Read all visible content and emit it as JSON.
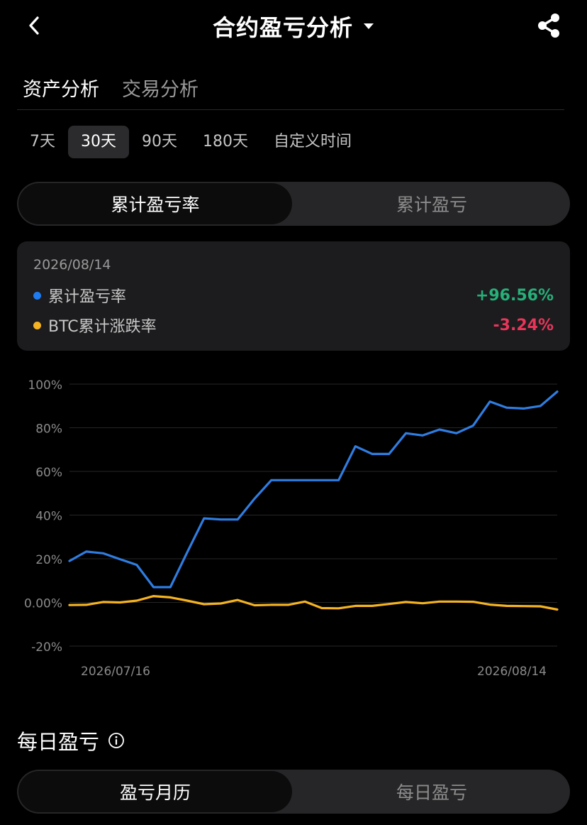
{
  "header": {
    "title": "合约盈亏分析",
    "back_icon": "chevron-left-icon",
    "dropdown_icon": "caret-down-icon",
    "share_icon": "share-icon"
  },
  "tabs": [
    {
      "label": "资产分析",
      "active": true
    },
    {
      "label": "交易分析",
      "active": false
    }
  ],
  "ranges": [
    {
      "label": "7天",
      "active": false
    },
    {
      "label": "30天",
      "active": true
    },
    {
      "label": "90天",
      "active": false
    },
    {
      "label": "180天",
      "active": false
    },
    {
      "label": "自定义时间",
      "active": false
    }
  ],
  "metric_toggle": {
    "left": "累计盈亏率",
    "right": "累计盈亏",
    "selected": "left"
  },
  "info_card": {
    "date": "2026/08/14",
    "rows": [
      {
        "label": "累计盈亏率",
        "value": "+96.56%",
        "dot_color": "#1e7cf0",
        "value_color": "#26b07a"
      },
      {
        "label": "BTC累计涨跌率",
        "value": "-3.24%",
        "dot_color": "#f5b321",
        "value_color": "#e8355a"
      }
    ]
  },
  "chart_data": {
    "type": "line",
    "x_start_label": "2026/07/16",
    "x_end_label": "2026/08/14",
    "y_ticks": [
      "100%",
      "80%",
      "60%",
      "40%",
      "20%",
      "0.00%",
      "-20%"
    ],
    "y_tick_values": [
      100,
      80,
      60,
      40,
      20,
      0,
      -20
    ],
    "ylim": [
      -20,
      100
    ],
    "grid": true,
    "series": [
      {
        "color": "#2f7de1",
        "values": [
          19,
          23.3,
          22.5,
          19.8,
          17.2,
          7,
          7,
          23,
          38.5,
          38,
          38,
          47.5,
          56,
          56,
          56,
          56,
          56,
          71.5,
          68,
          68,
          77.5,
          76.5,
          79.2,
          77.5,
          81,
          92,
          89.2,
          88.8,
          90,
          96.56
        ]
      },
      {
        "color": "#f5b321",
        "values": [
          -1.2,
          -1.1,
          0.2,
          0,
          0.8,
          2.9,
          2.3,
          0.8,
          -0.8,
          -0.5,
          1.1,
          -1.3,
          -1.1,
          -1.1,
          0.4,
          -2.6,
          -2.7,
          -1.6,
          -1.6,
          -0.7,
          0.2,
          -0.4,
          0.4,
          0.4,
          0.3,
          -1,
          -1.6,
          -1.7,
          -1.8,
          -3.24
        ]
      }
    ]
  },
  "daily_section": {
    "title": "每日盈亏",
    "info_icon": "info-circle-icon",
    "toggle": {
      "left": "盈亏月历",
      "right": "每日盈亏",
      "selected": "left"
    }
  }
}
